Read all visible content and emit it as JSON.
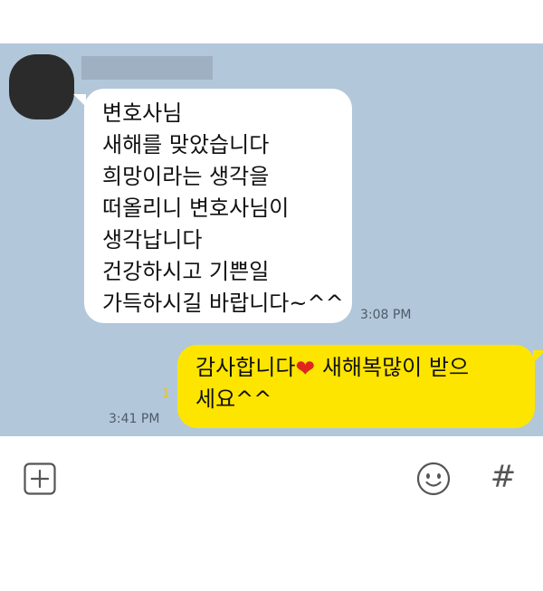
{
  "chat": {
    "incoming": {
      "sender_name": "",
      "lines": [
        "변호사님",
        "새해를 맞았습니다",
        "희망이라는 생각을",
        "떠올리니 변호사님이",
        "생각납니다",
        "건강하시고 기쁜일",
        "가득하시길 바랍니다~^^"
      ],
      "time": "3:08 PM"
    },
    "outgoing": {
      "line1_before_heart": "감사합니다",
      "heart": "❤",
      "line1_after_heart": " 새해복많이 받으",
      "line2": "세요^^",
      "unread_count": "1",
      "time": "3:41 PM"
    }
  },
  "input_bar": {
    "plus_icon": "plus-box-icon",
    "emoji_icon": "smiley-icon",
    "hash_icon": "hash-icon",
    "hash_glyph": "#"
  },
  "colors": {
    "chat_background": "#b2c7da",
    "outgoing_bubble": "#fee500",
    "incoming_bubble": "#ffffff",
    "heart": "#e0241f"
  }
}
